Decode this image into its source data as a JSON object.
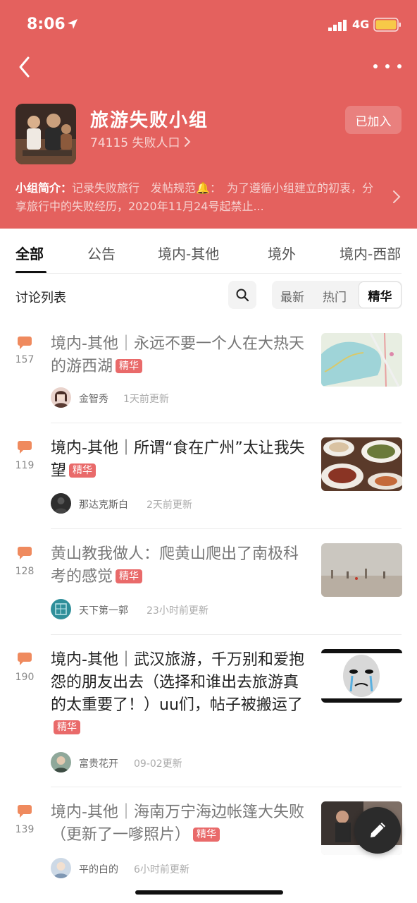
{
  "status_bar": {
    "time": "8:06",
    "network": "4G",
    "icons": [
      "location-arrow-icon",
      "signal-icon",
      "battery-icon"
    ]
  },
  "nav": {
    "back_icon": "chevron-left-icon",
    "more_icon": "more-dots-icon"
  },
  "group": {
    "title": "旅游失败小组",
    "members": "74115 失败人口",
    "joined_label": "已加入",
    "intro_label": "小组简介：",
    "intro_text": "记录失败旅行　发帖规范🔔：　为了遵循小组建立的初衷，分享旅行中的失败经历，2020年11月24号起禁止..."
  },
  "tabs": [
    {
      "label": "全部"
    },
    {
      "label": "公告"
    },
    {
      "label": "境内-其他"
    },
    {
      "label": "境外"
    },
    {
      "label": "境内-西部"
    }
  ],
  "list_header": {
    "title": "讨论列表",
    "sort_options": [
      "最新",
      "热门",
      "精华"
    ],
    "active_sort": "精华"
  },
  "badge_label": "精华",
  "posts": [
    {
      "comments": "157",
      "title": "境内-其他｜永远不要一个人在大热天的游西湖",
      "author": "金智秀",
      "time": "1天前更新",
      "read": true
    },
    {
      "comments": "119",
      "title": "境内-其他｜所谓“食在广州”太让我失望",
      "author": "那达克斯白",
      "time": "2天前更新",
      "read": false
    },
    {
      "comments": "128",
      "title": "黄山教我做人：爬黄山爬出了南极科考的感觉",
      "author": "天下第一郭",
      "time": "23小时前更新",
      "read": true
    },
    {
      "comments": "190",
      "title": "境内-其他｜武汉旅游，千万别和爱抱怨的朋友出去（选择和谁出去旅游真的太重要了！）uu们，帖子被搬运了",
      "author": "富贵花开",
      "time": "09-02更新",
      "read": false
    },
    {
      "comments": "139",
      "title": "境内-其他｜海南万宁海边帐篷大失败（更新了一嗲照片）",
      "author": "平的白的",
      "time": "6小时前更新",
      "read": true
    }
  ],
  "colors": {
    "brand": "#e4615e",
    "badge": "#e96a6a",
    "comment_icon": "#ef8a5e"
  }
}
